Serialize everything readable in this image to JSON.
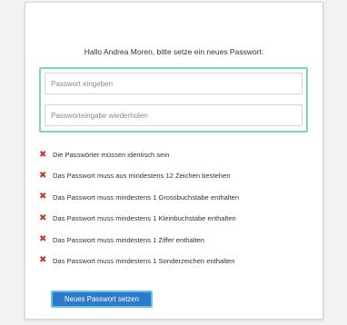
{
  "greeting": "Hallo Andrea Moren, bitte setze ein neues Passwort:",
  "form": {
    "password_placeholder": "Passwort eingeben",
    "password_repeat_placeholder": "Passworteingabe wiederholen",
    "submit_label": "Neues Passwort setzen"
  },
  "requirements": [
    {
      "text": "Die Passwörter müssen identisch sein",
      "icon": "cross-icon",
      "status": "unmet"
    },
    {
      "text": "Das Passwort muss aus mindestens 12 Zeichen bestehen",
      "icon": "cross-icon",
      "status": "unmet"
    },
    {
      "text": "Das Passwort muss mindestens 1 Grossbuchstabe enthalten",
      "icon": "cross-icon",
      "status": "unmet"
    },
    {
      "text": "Das Passwort muss mindestens 1 Kleinbuchstabe enthalten",
      "icon": "cross-icon",
      "status": "unmet"
    },
    {
      "text": "Das Passwort muss mindestens 1 Ziffer enthalten",
      "icon": "cross-icon",
      "status": "unmet"
    },
    {
      "text": "Das Passwort muss mindestens 1 Sonderzeichen enthalten",
      "icon": "cross-icon",
      "status": "unmet"
    }
  ],
  "colors": {
    "error": "#c0392b",
    "accent": "#2c7ac9",
    "field_group_border": "#7fd1c4"
  }
}
